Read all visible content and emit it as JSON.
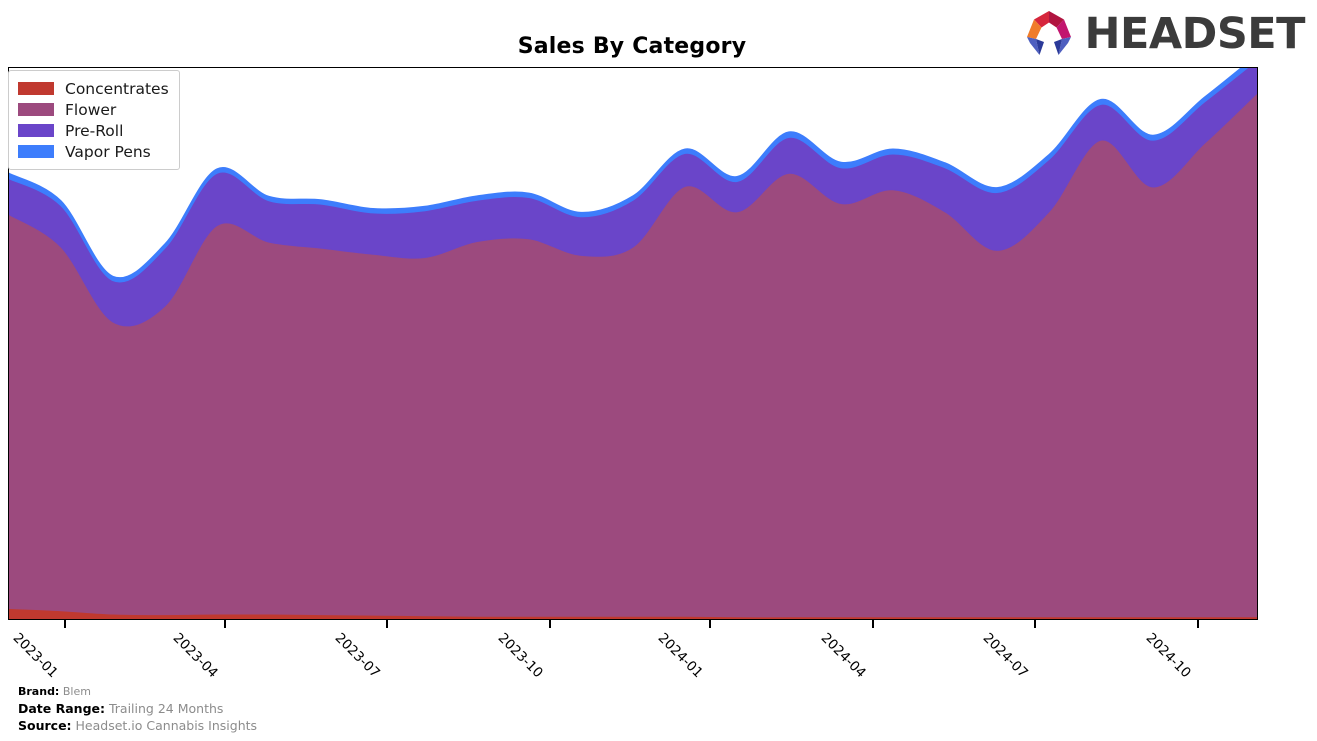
{
  "header": {
    "title": "Sales By Category",
    "logo_text": "HEADSET",
    "logo_colors": {
      "orange": "#f07c2a",
      "red": "#d6263c",
      "crimson": "#b01440",
      "magenta": "#c2166f",
      "blue_light": "#4e5fc0",
      "blue_dark": "#2b3a99"
    }
  },
  "legend": {
    "position": "top-left",
    "items": [
      {
        "label": "Concentrates",
        "color": "#c0392f"
      },
      {
        "label": "Flower",
        "color": "#9c4a7e"
      },
      {
        "label": "Pre-Roll",
        "color": "#6a45c9"
      },
      {
        "label": "Vapor Pens",
        "color": "#3d7dfc"
      }
    ]
  },
  "footer": {
    "brand_key": "Brand:",
    "brand_value": "Blem",
    "date_range_key": "Date Range:",
    "date_range_value": "Trailing 24 Months",
    "source_key": "Source:",
    "source_value": "Headset.io Cannabis Insights"
  },
  "chart_data": {
    "type": "area",
    "stacked": true,
    "title": "Sales By Category",
    "xlabel": "",
    "ylabel": "",
    "grid": false,
    "legend_position": "top-left",
    "axis_tick_labels": [
      "2023-01",
      "2023-04",
      "2023-07",
      "2023-10",
      "2024-01",
      "2024-04",
      "2024-07",
      "2024-10"
    ],
    "axis_tick_x_fraction": [
      0.0456,
      0.1736,
      0.3032,
      0.4336,
      0.5616,
      0.692,
      0.8216,
      0.952
    ],
    "x": [
      "2022-11",
      "2022-12",
      "2023-01",
      "2023-02",
      "2023-03",
      "2023-04",
      "2023-05",
      "2023-06",
      "2023-07",
      "2023-08",
      "2023-09",
      "2023-10",
      "2023-11",
      "2023-12",
      "2024-01",
      "2024-02",
      "2024-03",
      "2024-04",
      "2024-05",
      "2024-06",
      "2024-07",
      "2024-08",
      "2024-09",
      "2024-10",
      "2024-11"
    ],
    "ylim": [
      0,
      100
    ],
    "series": [
      {
        "name": "Concentrates",
        "color": "#c0392f",
        "values": [
          1.9,
          1.5,
          0.9,
          0.8,
          0.9,
          0.9,
          0.8,
          0.7,
          0.6,
          0.5,
          0.5,
          0.5,
          0.5,
          0.5,
          0.4,
          0.4,
          0.4,
          0.4,
          0.4,
          0.4,
          0.4,
          0.4,
          0.4,
          0.4,
          0.4
        ]
      },
      {
        "name": "Flower",
        "color": "#9c4a7e",
        "values": [
          71.5,
          66.0,
          53.0,
          56.0,
          70.5,
          67.5,
          66.5,
          65.5,
          65.0,
          68.0,
          68.5,
          65.5,
          67.0,
          78.0,
          73.5,
          80.5,
          75.0,
          77.5,
          73.5,
          66.5,
          73.5,
          86.5,
          78.0,
          86.0,
          95.0
        ]
      },
      {
        "name": "Pre-Roll",
        "color": "#6a45c9",
        "values": [
          6.5,
          7.5,
          7.5,
          10.5,
          9.5,
          7.5,
          8.0,
          7.5,
          8.5,
          7.5,
          7.5,
          7.0,
          8.5,
          6.0,
          5.5,
          6.5,
          6.5,
          6.5,
          8.0,
          10.5,
          9.5,
          6.5,
          8.5,
          7.5,
          6.0
        ]
      },
      {
        "name": "Vapor Pens",
        "color": "#3d7dfc",
        "values": [
          1.0,
          0.9,
          0.8,
          0.8,
          0.8,
          0.8,
          0.8,
          0.8,
          0.8,
          0.8,
          0.8,
          0.8,
          0.8,
          0.8,
          0.9,
          1.0,
          1.0,
          0.9,
          0.9,
          0.9,
          0.9,
          0.9,
          0.9,
          0.9,
          1.0
        ]
      }
    ]
  }
}
